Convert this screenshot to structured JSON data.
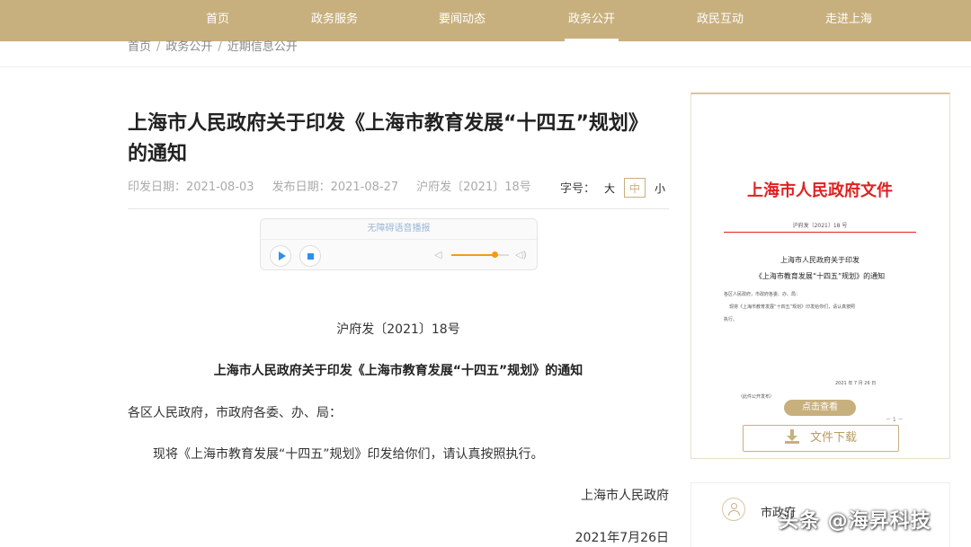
{
  "nav": {
    "items": [
      {
        "label": "首页"
      },
      {
        "label": "政务服务"
      },
      {
        "label": "要闻动态"
      },
      {
        "label": "政务公开",
        "active": true
      },
      {
        "label": "政民互动"
      },
      {
        "label": "走进上海"
      }
    ]
  },
  "breadcrumb": [
    "首页",
    "政务公开",
    "近期信息公开"
  ],
  "article": {
    "title": "上海市人民政府关于印发《上海市教育发展“十四五”规划》的通知",
    "issue_date": "印发日期：2021-08-03",
    "publish_date": "发布日期：2021-08-27",
    "doc_number": "沪府发〔2021〕18号",
    "font_size_label": "字号：",
    "font_sizes": [
      "大",
      "中",
      "小"
    ],
    "font_size_selected": "中"
  },
  "player": {
    "title": "无障碍语音播报",
    "volume": 0.75
  },
  "content": {
    "doc_number": "沪府发〔2021〕18号",
    "doc_title": "上海市人民政府关于印发《上海市教育发展“十四五”规划》的通知",
    "salutation": "各区人民政府，市政府各委、办、局：",
    "body": "现将《上海市教育发展“十四五”规划》印发给你们，请认真按照执行。",
    "signature": "上海市人民政府",
    "date": "2021年7月26日"
  },
  "sidebar": {
    "preview": {
      "header": "上海市人民政府文件",
      "doc_number": "沪府发〔2021〕18 号",
      "title_line1": "上海市人民政府关于印发",
      "title_line2": "《上海市教育发展“十四五”规划》的通知",
      "line1": "各区人民政府，市政府各委、办、局：",
      "line2": "现将《上海市教育发展“十四五”规划》印发给你们，请认真按照",
      "line3": "执行。",
      "date": "2021 年 7 月 26 日",
      "note": "（此件公开发布）",
      "page_marker": "－ 1 －"
    },
    "view_button": "点击查看",
    "download_button": "文件下载",
    "card2_label": "市政府"
  },
  "watermark": "头条 @海昇科技",
  "colors": {
    "nav_bg": "#c8b07e",
    "accent": "#c8b07e",
    "red_head": "#e02020",
    "player_blue": "#2d8ff0",
    "volume_orange": "#f39c12"
  }
}
